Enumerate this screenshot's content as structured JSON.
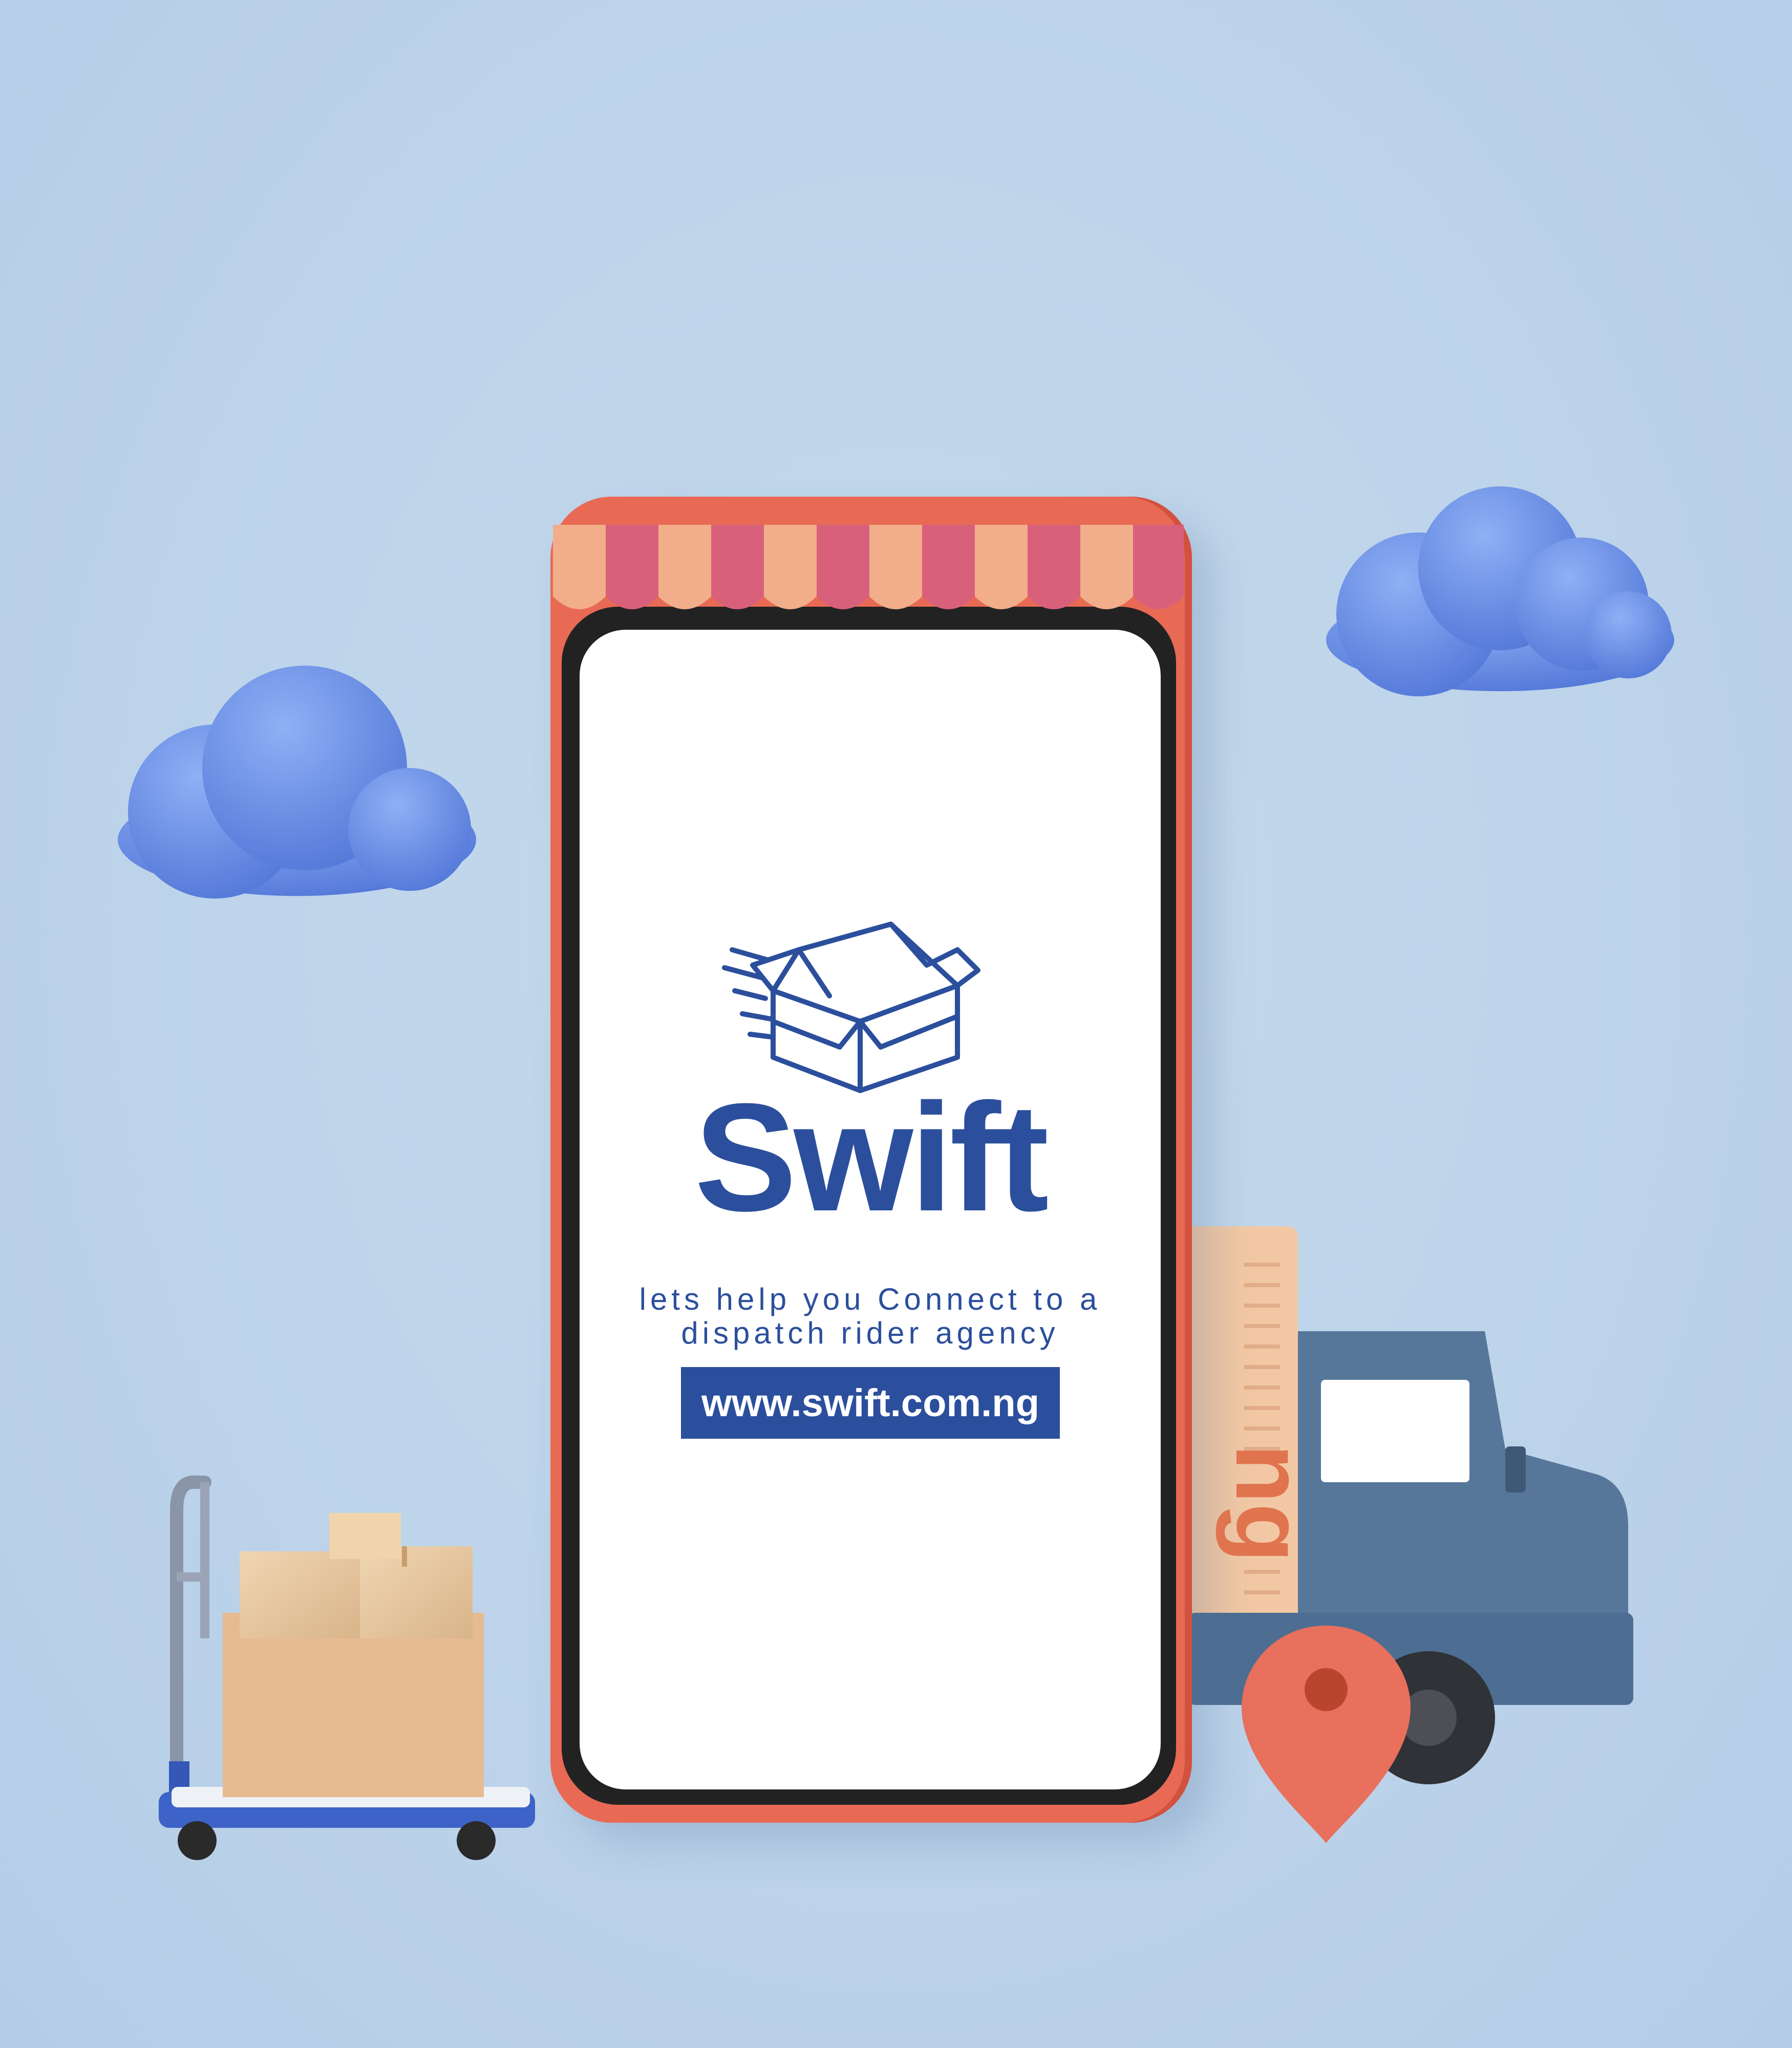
{
  "brand": {
    "name": "Swift",
    "tagline_line1": "lets help you Connect to a",
    "tagline_line2": "dispatch rider agency",
    "url": "www.swift.com.ng"
  },
  "truck": {
    "side_lettering": "ng"
  },
  "colors": {
    "background": "#bcd3ea",
    "brand_blue": "#2b4f9c",
    "phone_frame": "#e86a55",
    "awning_pink": "#d9607a",
    "awning_peach": "#f2ae8a",
    "cloud_blue": "#6b8fe6",
    "truck_blue": "#56779a"
  },
  "icons": {
    "logo": "open-box-icon",
    "pin": "location-pin-icon",
    "clouds": "cloud-icon"
  }
}
